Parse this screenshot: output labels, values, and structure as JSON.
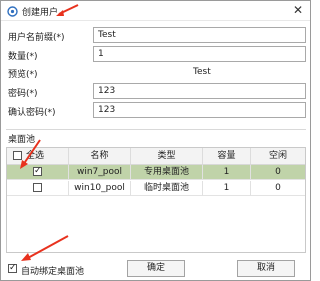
{
  "window": {
    "title": "创建用户",
    "close_glyph": "✕"
  },
  "form": {
    "prefix_label": "用户名前缀(*)",
    "prefix_value": "Test",
    "count_label": "数量(*)",
    "count_value": "1",
    "preview_label": "预览(*)",
    "preview_value": "Test",
    "password_label": "密码(*)",
    "password_value": "123",
    "confirm_label": "确认密码(*)",
    "confirm_value": "123"
  },
  "pool_group": {
    "label": "桌面池",
    "headers": [
      "全选",
      "名称",
      "类型",
      "容量",
      "空闲"
    ],
    "rows": [
      {
        "checked": true,
        "name": "win7_pool",
        "type": "专用桌面池",
        "capacity": "1",
        "free": "0"
      },
      {
        "checked": false,
        "name": "win10_pool",
        "type": "临时桌面池",
        "capacity": "1",
        "free": "0"
      }
    ]
  },
  "footer": {
    "auto_bind_label": "自动绑定桌面池",
    "auto_bind_checked": true,
    "ok_label": "确定",
    "cancel_label": "取消"
  },
  "colors": {
    "selected_row": "#c0d3a9",
    "annotation_arrow": "#e8321e"
  },
  "icons": [
    "app-icon",
    "close-icon",
    "checkbox-icon",
    "annotation-arrow-icon"
  ]
}
